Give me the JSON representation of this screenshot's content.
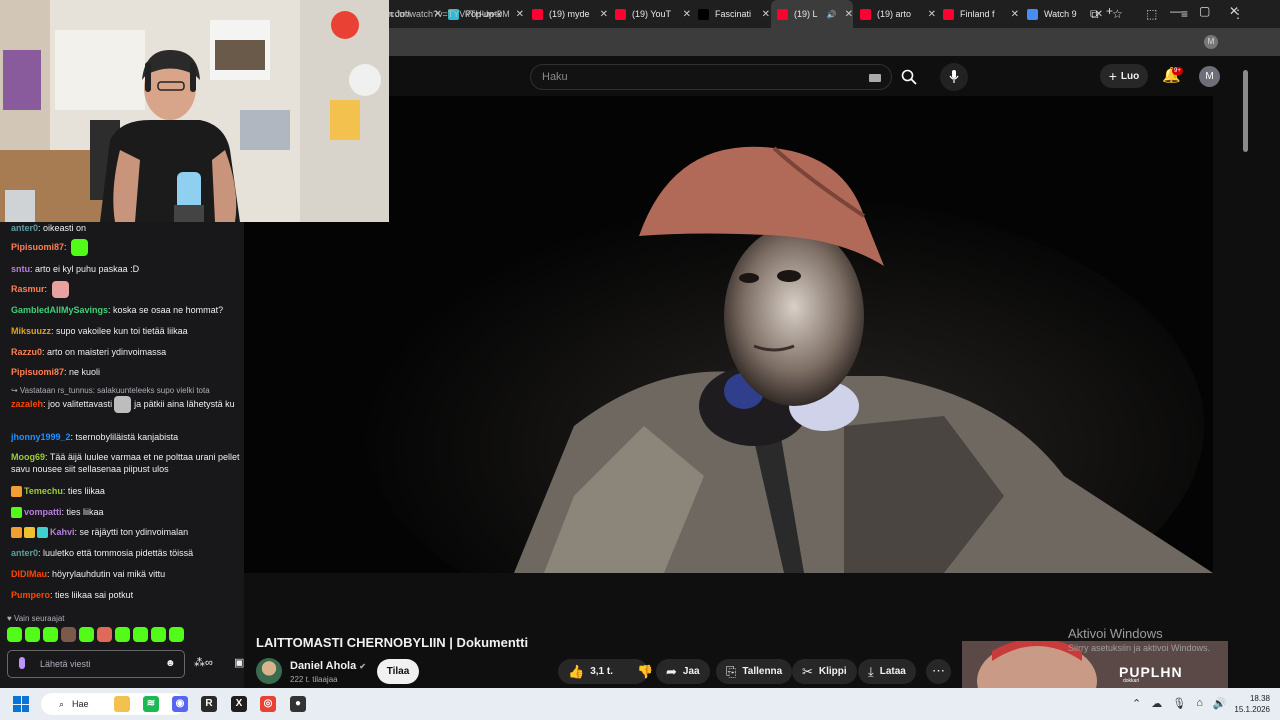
{
  "browser": {
    "tabs": [
      {
        "label": "an Joh",
        "favicon_color": "#9aa0a6",
        "active": false
      },
      {
        "label": "Pop-up-k",
        "favicon_color": "#2fbbd6",
        "active": false
      },
      {
        "label": "(19) myde",
        "favicon_color": "#ff0033",
        "active": false
      },
      {
        "label": "(19) YouT",
        "favicon_color": "#ff0033",
        "active": false
      },
      {
        "label": "Fascinati",
        "favicon_color": "#000000",
        "active": false
      },
      {
        "label": "(19) L",
        "favicon_color": "#ff0033",
        "active": true
      },
      {
        "label": "(19) arto",
        "favicon_color": "#ff0033",
        "active": false
      },
      {
        "label": "Finland f",
        "favicon_color": "#ff0033",
        "active": false
      },
      {
        "label": "Watch 9",
        "favicon_color": "#4a8cf7",
        "active": false
      }
    ],
    "new_tab": "+",
    "url": "com/watch?v=TYVkTHUwt9M",
    "profile_initial": "M"
  },
  "youtube": {
    "search_placeholder": "Haku",
    "create_label": "Luo",
    "notif_badge": "9+",
    "avatar_initial": "M",
    "video_title": "LAITTOMASTI CHERNOBYLIIN | Dokumentti",
    "channel_name": "Daniel Ahola",
    "verified_mark": "✔",
    "subscribers": "222 t. tilaajaa",
    "subscribe_label": "Tilaa",
    "likes": "3,1 t.",
    "share_label": "Jaa",
    "save_label": "Tallenna",
    "clip_label": "Klippi",
    "download_label": "Lataa",
    "miniplayer_logo": "PUPLHN",
    "miniplayer_sub": "dokkari"
  },
  "windows_watermark": {
    "line1": "Aktivoi Windows",
    "line2": "Siirry asetuksiin ja aktivoi Windows."
  },
  "chat": {
    "messages": [
      {
        "user": "anter0",
        "color": "#5f9ea0",
        "text": "oikeasti on",
        "emote": null,
        "badges": []
      },
      {
        "user": "Pipisuomi87",
        "color": "#ff7f50",
        "text": "",
        "emote": "#53fc18",
        "badges": []
      },
      {
        "user": "sntu",
        "color": "#b57edc",
        "text": "arto ei kyl puhu paskaa :D",
        "emote": null,
        "badges": []
      },
      {
        "user": "Rasmur",
        "color": "#ff7f50",
        "text": "",
        "emote": "#e8a0a0",
        "badges": []
      },
      {
        "user": "GambledAllMySavings",
        "color": "#3fd07a",
        "text": "koska se osaa ne hommat?",
        "emote": null,
        "badges": []
      },
      {
        "user": "Miksuuzz",
        "color": "#daa520",
        "text": "supo vakoilee kun toi tietää liikaa",
        "emote": null,
        "badges": []
      },
      {
        "user": "Razzu0",
        "color": "#ff7f50",
        "text": "arto on maisteri ydinvoimassa",
        "emote": null,
        "badges": []
      },
      {
        "user": "Pipisuomi87",
        "color": "#ff7f50",
        "text": "ne kuoli",
        "emote": null,
        "badges": []
      },
      {
        "user": "zazaleh",
        "color": "#ff4500",
        "text": "joo valitettavasti",
        "text2": "ja pätkii aina lähetystä ku",
        "emote": "#bdbdbd",
        "badges": []
      },
      {
        "user": "jhonny1999_2",
        "color": "#1e90ff",
        "text": "tsernobyliläistä kanjabista",
        "emote": null,
        "badges": []
      },
      {
        "user": "Moog69",
        "color": "#9acd32",
        "text": "Tää äijä luulee varmaa et ne polttaa urani pellet",
        "text2": "savu nousee siit sellasenaa piipust ulos",
        "emote": null,
        "badges": []
      },
      {
        "user": "Temechu",
        "color": "#9acd32",
        "text": "ties liikaa",
        "emote": null,
        "badges": [
          "#f0a030"
        ]
      },
      {
        "user": "vompatti",
        "color": "#b57edc",
        "text": "ties liikaa",
        "emote": null,
        "badges": [
          "#53fc18"
        ]
      },
      {
        "user": "Kahvi",
        "color": "#b57edc",
        "text": "se räjäytti ton ydinvoimalan",
        "emote": null,
        "badges": [
          "#f0a030",
          "#f0c030",
          "#3fd0d0"
        ]
      },
      {
        "user": "anter0",
        "color": "#5f9ea0",
        "text": "luuletko että tommosia pidettäs töissä",
        "emote": null,
        "badges": []
      },
      {
        "user": "DIDIMau",
        "color": "#ff4500",
        "text": "höyrylauhdutin vai mikä vittu",
        "emote": null,
        "badges": []
      },
      {
        "user": "Pumpero",
        "color": "#ff4500",
        "text": "ties liikaa sai potkut",
        "emote": null,
        "badges": []
      }
    ],
    "reply_header": "↪ Vastataan rs_tunnus: salakuunteleeks supo vielki tota",
    "followers_only": "♥ Vain seuraajat",
    "emote_colors": [
      "#53fc18",
      "#53fc18",
      "#53fc18",
      "#7a5b4a",
      "#53fc18",
      "#e06a5a",
      "#53fc18",
      "#53fc18",
      "#53fc18",
      "#53fc18"
    ],
    "input_placeholder": "Lähetä viesti"
  },
  "taskbar": {
    "search_label": "Hae",
    "apps": [
      {
        "name": "file-explorer",
        "color": "#f2c14e",
        "glyph": ""
      },
      {
        "name": "spotify",
        "color": "#1db954",
        "glyph": "≋"
      },
      {
        "name": "discord",
        "color": "#5865f2",
        "glyph": "◉"
      },
      {
        "name": "app-r",
        "color": "#2a2a2a",
        "glyph": "R"
      },
      {
        "name": "app-x",
        "color": "#1e1e1e",
        "glyph": "X"
      },
      {
        "name": "chrome",
        "color": "#e94235",
        "glyph": "◎"
      },
      {
        "name": "obs",
        "color": "#333333",
        "glyph": "●"
      }
    ],
    "time": "18.38",
    "date": "15.1.2026"
  }
}
